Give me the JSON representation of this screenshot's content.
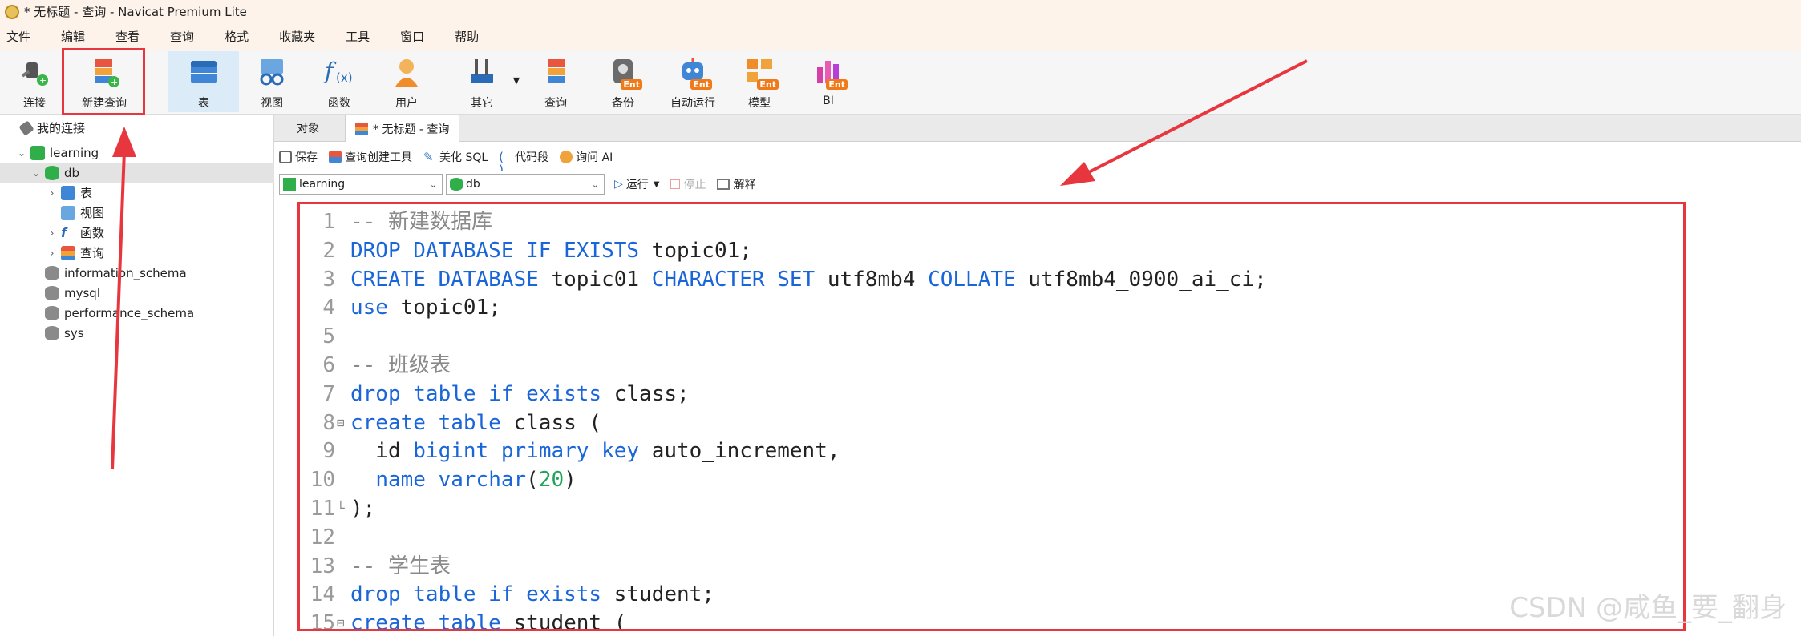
{
  "window": {
    "title": "* 无标题 - 查询 - Navicat Premium Lite"
  },
  "menu": [
    "文件",
    "编辑",
    "查看",
    "查询",
    "格式",
    "收藏夹",
    "工具",
    "窗口",
    "帮助"
  ],
  "toolbar": [
    {
      "label": "连接",
      "icon": "plug-connection-icon"
    },
    {
      "label": "新建查询",
      "icon": "new-query-icon"
    },
    {
      "label": "表",
      "icon": "table-icon"
    },
    {
      "label": "视图",
      "icon": "view-icon"
    },
    {
      "label": "函数",
      "icon": "function-icon"
    },
    {
      "label": "用户",
      "icon": "user-icon"
    },
    {
      "label": "其它",
      "icon": "tools-icon"
    },
    {
      "label": "查询",
      "icon": "query-icon"
    },
    {
      "label": "备份",
      "icon": "backup-icon",
      "badge": "Ent"
    },
    {
      "label": "自动运行",
      "icon": "robot-icon",
      "badge": "Ent"
    },
    {
      "label": "模型",
      "icon": "model-icon",
      "badge": "Ent"
    },
    {
      "label": "BI",
      "icon": "bi-icon",
      "badge": "Ent"
    }
  ],
  "tree": {
    "root": "我的连接",
    "connection": "learning",
    "db": "db",
    "db_children": [
      "表",
      "视图",
      "函数",
      "查询"
    ],
    "other_dbs": [
      "information_schema",
      "mysql",
      "performance_schema",
      "sys"
    ]
  },
  "tabs": {
    "objects": "对象",
    "query_tab": "* 无标题 - 查询"
  },
  "query_toolbar": [
    "保存",
    "查询创建工具",
    "美化 SQL",
    "代码段",
    "询问 AI"
  ],
  "db_bar": {
    "connection": "learning",
    "database": "db",
    "run": "运行",
    "stop": "停止",
    "explain": "解释"
  },
  "editor_lines": [
    {
      "n": "1",
      "tokens": [
        {
          "t": "-- 新建数据库",
          "c": "cm"
        }
      ]
    },
    {
      "n": "2",
      "tokens": [
        {
          "t": "DROP DATABASE IF EXISTS",
          "c": "kw"
        },
        {
          "t": " topic01;",
          "c": "plain"
        }
      ]
    },
    {
      "n": "3",
      "tokens": [
        {
          "t": "CREATE DATABASE",
          "c": "kw"
        },
        {
          "t": " topic01 ",
          "c": "plain"
        },
        {
          "t": "CHARACTER SET",
          "c": "kw"
        },
        {
          "t": " utf8mb4 ",
          "c": "plain"
        },
        {
          "t": "COLLATE",
          "c": "kw"
        },
        {
          "t": " utf8mb4_0900_ai_ci;",
          "c": "plain"
        }
      ]
    },
    {
      "n": "4",
      "tokens": [
        {
          "t": "use",
          "c": "kw"
        },
        {
          "t": " topic01;",
          "c": "plain"
        }
      ]
    },
    {
      "n": "5",
      "tokens": []
    },
    {
      "n": "6",
      "tokens": [
        {
          "t": "-- 班级表",
          "c": "cm"
        }
      ]
    },
    {
      "n": "7",
      "tokens": [
        {
          "t": "drop table if exists",
          "c": "kw"
        },
        {
          "t": " class;",
          "c": "plain"
        }
      ]
    },
    {
      "n": "8",
      "fold": "⊟",
      "tokens": [
        {
          "t": "create table",
          "c": "kw"
        },
        {
          "t": " class (",
          "c": "plain"
        }
      ]
    },
    {
      "n": "9",
      "tokens": [
        {
          "t": "  id ",
          "c": "plain"
        },
        {
          "t": "bigint primary key",
          "c": "kw"
        },
        {
          "t": " auto_increment,",
          "c": "plain"
        }
      ]
    },
    {
      "n": "10",
      "tokens": [
        {
          "t": "  ",
          "c": "plain"
        },
        {
          "t": "name varchar",
          "c": "kw"
        },
        {
          "t": "(",
          "c": "plain"
        },
        {
          "t": "20",
          "c": "num"
        },
        {
          "t": ")",
          "c": "plain"
        }
      ]
    },
    {
      "n": "11",
      "fold": "└",
      "tokens": [
        {
          "t": ");",
          "c": "plain"
        }
      ]
    },
    {
      "n": "12",
      "tokens": []
    },
    {
      "n": "13",
      "tokens": [
        {
          "t": "-- 学生表",
          "c": "cm"
        }
      ]
    },
    {
      "n": "14",
      "tokens": [
        {
          "t": "drop table if exists",
          "c": "kw"
        },
        {
          "t": " student;",
          "c": "plain"
        }
      ]
    },
    {
      "n": "15",
      "fold": "⊟",
      "tokens": [
        {
          "t": "create table",
          "c": "kw"
        },
        {
          "t": " student (",
          "c": "plain"
        }
      ]
    }
  ],
  "watermark": "CSDN @咸鱼_要_翻身",
  "colors": {
    "accent_red": "#e8363f",
    "keyword": "#1a66d9",
    "comment": "#8a8a8a",
    "number": "#21a35a"
  }
}
